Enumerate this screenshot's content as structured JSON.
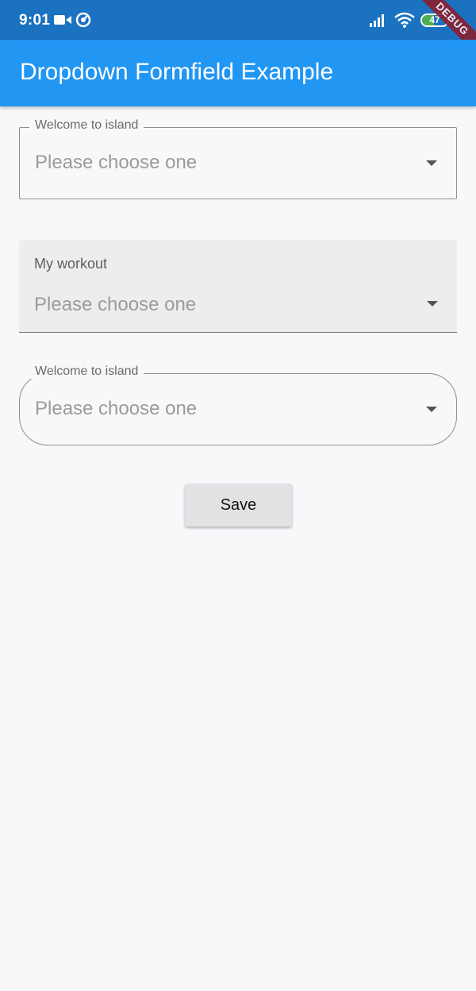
{
  "status_bar": {
    "time": "9:01",
    "battery_level": "47",
    "icons": [
      "video-camera-icon",
      "sync-icon",
      "signal-icon",
      "wifi-icon",
      "battery-icon"
    ]
  },
  "debug_banner": "DEBUG",
  "app_bar": {
    "title": "Dropdown Formfield Example",
    "color": "#2196f3"
  },
  "form": {
    "field1": {
      "label": "Welcome to island",
      "hint": "Please choose one",
      "style": "outlined"
    },
    "field2": {
      "label": "My workout",
      "hint": "Please choose one",
      "style": "filled"
    },
    "field3": {
      "label": "Welcome to island",
      "hint": "Please choose one",
      "style": "outlined-rounded"
    },
    "save_label": "Save"
  }
}
